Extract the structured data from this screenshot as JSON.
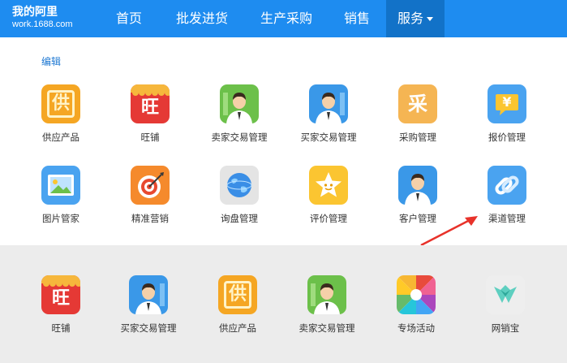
{
  "brand": {
    "title": "我的阿里",
    "subtitle": "work.1688.com"
  },
  "nav": {
    "items": [
      {
        "label": "首页"
      },
      {
        "label": "批发进货"
      },
      {
        "label": "生产采购"
      },
      {
        "label": "销售"
      },
      {
        "label": "服务"
      }
    ]
  },
  "edit_label": "编辑",
  "grid": {
    "row1": [
      {
        "label": "供应产品",
        "icon": "gong-supply-icon",
        "glyph": "供"
      },
      {
        "label": "旺铺",
        "icon": "wang-shop-icon",
        "glyph": "旺"
      },
      {
        "label": "卖家交易管理",
        "icon": "seller-avatar-icon"
      },
      {
        "label": "买家交易管理",
        "icon": "buyer-avatar-icon"
      },
      {
        "label": "采购管理",
        "icon": "cai-purchase-icon",
        "glyph": "采"
      },
      {
        "label": "报价管理",
        "icon": "quote-yen-bubble-icon",
        "glyph": "¥"
      }
    ],
    "row2": [
      {
        "label": "图片管家",
        "icon": "picture-icon"
      },
      {
        "label": "精准营销",
        "icon": "target-icon"
      },
      {
        "label": "询盘管理",
        "icon": "globe-icon"
      },
      {
        "label": "评价管理",
        "icon": "star-face-icon"
      },
      {
        "label": "客户管理",
        "icon": "customer-avatar-icon"
      },
      {
        "label": "渠道管理",
        "icon": "channel-link-icon"
      }
    ]
  },
  "recommended": [
    {
      "label": "旺铺",
      "icon": "wang-shop-icon",
      "glyph": "旺"
    },
    {
      "label": "买家交易管理",
      "icon": "buyer-avatar-icon"
    },
    {
      "label": "供应产品",
      "icon": "gong-supply-icon",
      "glyph": "供"
    },
    {
      "label": "卖家交易管理",
      "icon": "seller-avatar-icon"
    },
    {
      "label": "专场活动",
      "icon": "petal-activity-icon"
    },
    {
      "label": "网销宝",
      "icon": "wangxiaobao-logo-icon"
    }
  ],
  "colors": {
    "nav_bg": "#1e8cf0",
    "nav_active": "#1272c8",
    "edit_link": "#1e78d2",
    "arrow": "#e8322a",
    "gray_panel": "#ececec"
  }
}
